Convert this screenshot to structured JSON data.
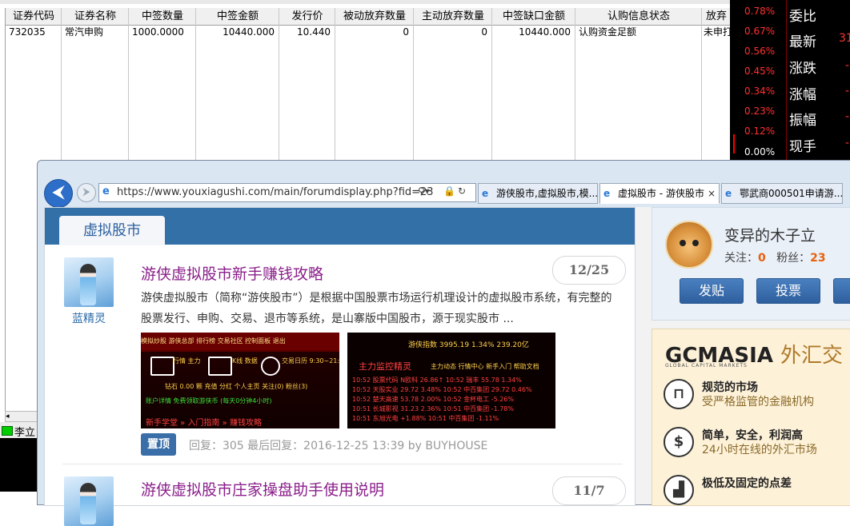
{
  "table": {
    "headers": [
      "证券代码",
      "证券名称",
      "中签数量",
      "中签金额",
      "发行价",
      "被动放弃数量",
      "主动放弃数量",
      "中签缺口金额",
      "认购信息状态",
      "放弃"
    ],
    "row": [
      "732035",
      "常汽申购",
      "1000.0000",
      "10440.000",
      "10.440",
      "0",
      "0",
      "10440.000",
      "认购资金足额",
      "未申打"
    ]
  },
  "status": {
    "label": "李立"
  },
  "market": {
    "pcts": [
      "0.78%",
      "0.67%",
      "0.56%",
      "0.45%",
      "0.34%",
      "0.23%",
      "0.12%",
      "0.00%"
    ],
    "labels": [
      "委比",
      "最新",
      "涨跌",
      "涨幅",
      "振幅",
      "现手"
    ],
    "last_value": "31",
    "colors": {
      "up": "#ff3030",
      "bg": "#000000"
    }
  },
  "browser": {
    "url": "https://www.youxiagushi.com/main/forumdisplay.php?fid=23",
    "tabs": [
      {
        "label": "游侠股市,虚拟股市,模..."
      },
      {
        "label": "虚拟股市 - 游侠股市"
      },
      {
        "label": "鄂武商000501申请游..."
      }
    ]
  },
  "forum": {
    "section_tab": "虚拟股市",
    "threads": [
      {
        "author": "蓝精灵",
        "title": "游侠虚拟股市新手赚钱攻略",
        "count": "12/25",
        "excerpt": "游侠虚拟股市（简称“游侠股市”）是根据中国股票市场运行机理设计的虚拟股市系统，有完整的股票发行、申购、交易、退市等系统，是山寨版中国股市，源于现实股市 ...",
        "badge": "置顶",
        "meta": "回复：305   最后回复：2016-12-25 13:39 by BUYHOUSE"
      },
      {
        "author": "蓝精灵",
        "title": "游侠虚拟股市庄家操盘助手使用说明",
        "count": "11/7"
      }
    ],
    "shot1": {
      "menu": "模拟炒股   游侠总部   排行榜   交易社区   控制面板   退出",
      "icons_text": [
        "行情 主力",
        "K线 数据",
        "交易日历 9:30~21:30"
      ],
      "line1": "钻石 0.00 颗    充值    分红    个人主页    关注(0)    粉丝(3)",
      "line2": "账户详情                   免费领取游侠币 (每天0分钟4小时)",
      "line3": "新手学堂 » 入门指南 » 赚钱攻略"
    },
    "shot2": {
      "index_line": "游侠指数   3995.19   1.34%   239.20亿",
      "title": "主力监控精灵",
      "tabs": "主力动态   行情中心   新手入门   帮助文档",
      "rows": [
        "10:52  股票代码  N欧科  26.86↑   10:52  瑞丰  55.78  1.34%",
        "10:52  天股实业  29.72  3.48%   10:52  中百集团  29.72  0.46%",
        "10:52  楚天高速  53.78  2.00%   10:52  金杯电工  -5.26%",
        "10:51  长城影视  31.23  2.36%   10:51  中百集团  -1.78%",
        "10:51  东旭光电  +1.88%   10:51  中百集团  -1.11%"
      ]
    }
  },
  "user": {
    "name": "变异的木子立",
    "follow_label": "关注：",
    "follow": "0",
    "fans_label": "粉丝：",
    "fans": "23",
    "buttons": [
      "发贴",
      "投票"
    ]
  },
  "ad": {
    "logo_latin_1": "GCM",
    "logo_latin_2": "ASIA",
    "logo_cn": "外汇交",
    "sub": "GLOBAL CAPITAL MARKETS",
    "items": [
      {
        "icon": "lock-icon",
        "title": "规范的市场",
        "sub": "受严格监管的金融机构"
      },
      {
        "icon": "dollar-icon",
        "title": "简单，安全，利润高",
        "sub": "24小时在线的外汇市场"
      },
      {
        "icon": "chart-icon",
        "title": "极低及固定的点差",
        "sub": ""
      }
    ]
  }
}
